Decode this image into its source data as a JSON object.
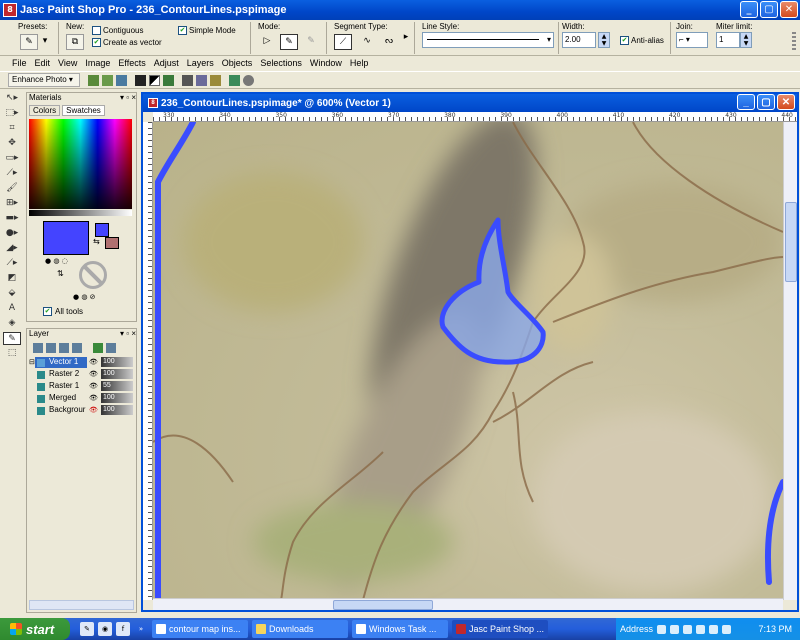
{
  "window": {
    "title": "Jasc Paint Shop Pro - 236_ContourLines.pspimage",
    "app_icon": "8"
  },
  "tool_options": {
    "presets_label": "Presets:",
    "new_label": "New:",
    "contiguous_label": "Contiguous",
    "create_vector_label": "Create as vector",
    "simple_mode_label": "Simple Mode",
    "mode_label": "Mode:",
    "segment_type_label": "Segment Type:",
    "line_style_label": "Line Style:",
    "width_label": "Width:",
    "width_value": "2.00",
    "antialias_label": "Anti-alias",
    "join_label": "Join:",
    "miter_label": "Miter limit:",
    "miter_value": "1"
  },
  "menu": [
    "File",
    "Edit",
    "View",
    "Image",
    "Effects",
    "Adjust",
    "Layers",
    "Objects",
    "Selections",
    "Window",
    "Help"
  ],
  "toolbar2": {
    "enhance_photo": "Enhance Photo ▾"
  },
  "materials": {
    "title": "Materials",
    "tab_colors": "Colors",
    "tab_swatches": "Swatches",
    "fg_color": "#4444ff",
    "bg_color": "#b07070",
    "all_tools_label": "All tools"
  },
  "layers": {
    "title": "Layer",
    "rows": [
      {
        "name": "Vector 1",
        "opacity": "100",
        "selected": true
      },
      {
        "name": "Raster 2",
        "opacity": "100",
        "selected": false
      },
      {
        "name": "Raster 1",
        "opacity": "55",
        "selected": false
      },
      {
        "name": "Merged",
        "opacity": "100",
        "selected": false
      },
      {
        "name": "Backgrour",
        "opacity": "100",
        "selected": false
      }
    ]
  },
  "image_window": {
    "title": "236_ContourLines.pspimage* @ 600% (Vector 1)",
    "ruler_ticks": [
      "330",
      "340",
      "350",
      "360",
      "370",
      "380",
      "390",
      "400",
      "410",
      "420",
      "430",
      "440"
    ]
  },
  "taskbar": {
    "start": "start",
    "tasks": [
      {
        "label": "contour map ins...",
        "active": false
      },
      {
        "label": "Downloads",
        "active": false
      },
      {
        "label": "Windows Task ...",
        "active": false
      },
      {
        "label": "Jasc Paint Shop ...",
        "active": true
      }
    ],
    "address_label": "Address",
    "clock": "7:13 PM"
  },
  "colors": {
    "contour_line": "#8a6a48",
    "vector_stroke": "#3a4cff",
    "vector_fill": "#8aa8e8"
  }
}
